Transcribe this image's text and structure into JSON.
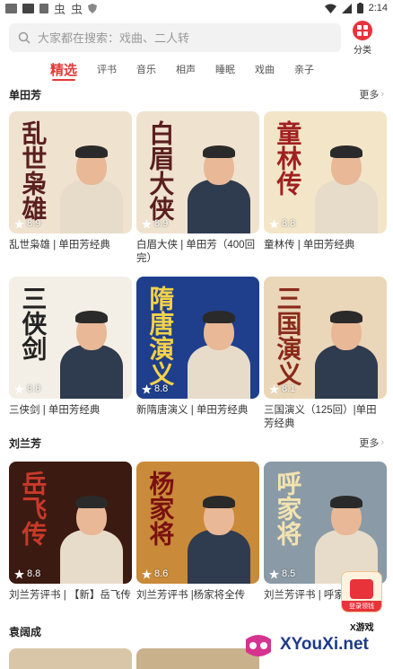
{
  "status_bar": {
    "left_icons": [
      "app-notification-icon",
      "picture-icon",
      "image-icon",
      "app-icon",
      "app-icon",
      "shield-icon"
    ],
    "time": "2:14"
  },
  "search": {
    "placeholder": "大家都在搜索：戏曲、二人转"
  },
  "category_button": {
    "label": "分类",
    "icon": "grid-icon"
  },
  "tabs": [
    {
      "label": "精选",
      "active": true
    },
    {
      "label": "评书"
    },
    {
      "label": "音乐"
    },
    {
      "label": "相声"
    },
    {
      "label": "睡眠"
    },
    {
      "label": "戏曲"
    },
    {
      "label": "亲子"
    }
  ],
  "sections": [
    {
      "title": "单田芳",
      "more": "更多",
      "items": [
        {
          "caption": "乱世枭雄 | 单田芳经典",
          "rating": "8.9",
          "cover_text": "乱世枭雄",
          "cover_bg": "#efe2cf",
          "cover_text_color": "#5a1f1f"
        },
        {
          "caption": "白眉大侠 | 单田芳（400回完）",
          "rating": "8.9",
          "cover_text": "白眉大侠",
          "cover_bg": "#efe2cf",
          "cover_text_color": "#5a1f1f"
        },
        {
          "caption": "童林传 | 单田芳经典",
          "rating": "8.8",
          "cover_text": "童林传",
          "cover_bg": "#f3e6c8",
          "cover_text_color": "#a02020"
        },
        {
          "caption": "三侠剑 | 单田芳经典",
          "rating": "8.8",
          "cover_text": "三侠剑",
          "cover_bg": "#f4efe6",
          "cover_text_color": "#222222"
        },
        {
          "caption": "新隋唐演义 | 单田芳经典",
          "rating": "8.8",
          "cover_text": "隋唐演义",
          "cover_bg": "#1f3f8c",
          "cover_text_color": "#f3d24a"
        },
        {
          "caption": "三国演义（125回）|单田芳经典",
          "rating": "8.1",
          "cover_text": "三国演义",
          "cover_bg": "#ead6b8",
          "cover_text_color": "#8a2a1a"
        }
      ]
    },
    {
      "title": "刘兰芳",
      "more": "更多",
      "items": [
        {
          "caption": "刘兰芳评书 | 【新】岳飞传",
          "rating": "8.8",
          "cover_text": "岳飞传",
          "cover_bg": "#3b1a12",
          "cover_text_color": "#c73a2a"
        },
        {
          "caption": "刘兰芳评书 |杨家将全传",
          "rating": "8.6",
          "cover_text": "杨家将",
          "cover_bg": "#c98a3a",
          "cover_text_color": "#7a1010"
        },
        {
          "caption": "刘兰芳评书 | 呼家",
          "rating": "8.5",
          "cover_text": "呼家将",
          "cover_bg": "#8a9aa6",
          "cover_text_color": "#f3e3b0"
        }
      ]
    },
    {
      "title": "袁阔成"
    }
  ],
  "floating_badge": {
    "label": "登录领钱"
  },
  "watermark": {
    "text": "XYouXi.net",
    "small": "X游戏"
  }
}
